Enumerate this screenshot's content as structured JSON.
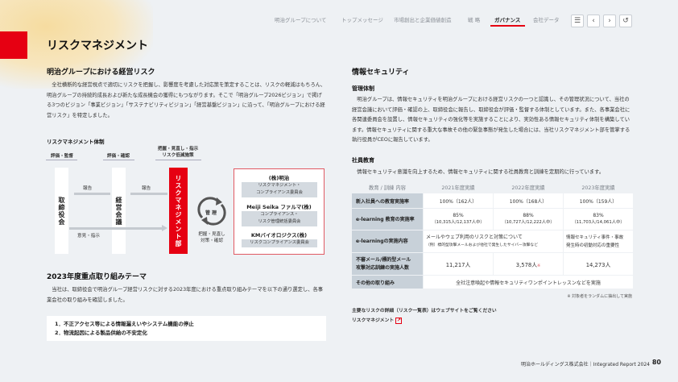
{
  "page_title": "リスクマネジメント",
  "nav": {
    "items": [
      "明治グループについて",
      "トップメッセージ",
      "市場創出と企業価値創造",
      "戦 略",
      "ガバナンス",
      "会社データ"
    ],
    "active": "ガバナンス",
    "buttons": [
      "list-icon",
      "prev-icon",
      "next-icon",
      "undo-icon"
    ]
  },
  "left": {
    "heading": "明治グループにおける経営リスク",
    "paragraph": "全社横断的な経営視点で適切にリスクを把握し、影響度を考慮した対応策を策定することは、リスクの軽減はもちろん、明治グループの持続的成長および新たな成長機会の獲得にもつながります。そこで「明治グループ2026ビジョン」で掲げる3つのビジョン「事業ビジョン」「サステナビリティビジョン」「経営基盤ビジョン」に沿って、「明治グループにおける経営リスク」を特定しました。",
    "diagram": {
      "title": "リスクマネジメント体制",
      "board_top": "評価・監督",
      "board": "取締役会",
      "mgmt_top": "評価・確認",
      "mgmt": "経営会議",
      "rm_top_1": "把握・見直し・指示",
      "rm_top_2": "リスク低減施策",
      "rm": "リスクマネジメント部",
      "report1": "報告",
      "report2": "報告",
      "opinion": "意見・指示",
      "cycle": "管 理",
      "cycle_sub_1": "把握・見直し",
      "cycle_sub_2": "対策・確認",
      "companies": [
        {
          "name": "(株)明治",
          "committee_1": "リスクマネジメント・",
          "committee_2": "コンプライアンス委員会"
        },
        {
          "name": "Meiji Seika ファルマ(株)",
          "committee_1": "コンプライアンス・",
          "committee_2": "リスク管理統括委員会"
        },
        {
          "name": "KMバイオロジクス(株)",
          "committee_1": "リスクコンプライアンス委員会",
          "committee_2": ""
        }
      ]
    },
    "theme_heading": "2023年度重点取り組みテーマ",
    "theme_paragraph": "当社は、取締役会で明治グループ経営リスクに対する2023年度における重点取り組みテーマを以下の通り選定し、各事業会社の取り組みを確認しました。",
    "themes": [
      "1．不正アクセス等による情報漏えいやシステム機能の停止",
      "2．物流起因による製品供給の不安定化"
    ]
  },
  "right": {
    "heading": "情報セキュリティ",
    "sub1": "管理体制",
    "para1": "明治グループは、情報セキュリティを明治グループにおける経営リスクの一つと認識し、その管理状況について、当社の経営会議において評価・確認の上、取締役会に報告し、取締役会が評価・監督する体制としています。また、各事業会社に各関連委員会を設置し、情報セキュリティの強化等を実施することにより、実効性ある情報セキュリティ体制を構築しています。情報セキュリティに関する重大な事故その他の緊急事態が発生した場合には、当社リスクマネジメント部を管掌する執行役員がCEOに報告しています。",
    "sub2": "社員教育",
    "para2": "情報セキュリティ意識を向上するため、情報セキュリティに関する社員教育と訓練を定期的に行っています。",
    "table": {
      "headers": [
        "教育 / 訓練 内容",
        "2021年度実績",
        "2022年度実績",
        "2023年度実績"
      ],
      "rows": [
        {
          "label": "新入社員への教育実施率",
          "c1": "100%（162人）",
          "c2": "100%（168人）",
          "c3": "100%（159人）"
        },
        {
          "label": "e-learning 教育の実施率",
          "c1": "85%",
          "c1b": "（10,315人/12,137人中）",
          "c2": "88%",
          "c2b": "（10,727人/12,222人中）",
          "c3": "83%",
          "c3b": "（11,703人/14,061人中）"
        },
        {
          "label": "e-learningの実施内容",
          "c12": "メールやウェブ利用のリスクと対策について",
          "c12b": "（例）標的型攻撃メールおよび他社で発生したサイバー攻撃など",
          "c3": "情報セキュリティ事件・事故",
          "c3b": "発生時の初動対応の重要性"
        },
        {
          "label": "不審メール/標的型メール",
          "label_b": "攻撃対応訓練の実施人数",
          "c1": "11,217人",
          "c2": "3,578人",
          "c2_mark": "※",
          "c3": "14,273人"
        },
        {
          "label": "その他の取り組み",
          "all": "全社注意喚起や情報セキュリティワンポイントレッスンなどを実施"
        }
      ]
    },
    "footnote": "※ 対象者をランダムに抽出して実施",
    "link_intro": "主要なリスクの詳細（リスク一覧表）はウェブサイトをご覧ください",
    "link_text": "リスクマネジメント"
  },
  "footer": {
    "text": "明治ホールディングス株式会社｜Integrated Report 2024",
    "page": "80"
  },
  "colors": {
    "accent": "#e60012",
    "background": "#eef1f4",
    "table_header": "#c8d1d9"
  }
}
